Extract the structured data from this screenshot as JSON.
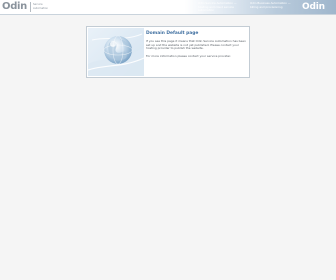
{
  "header": {
    "logo_text": "Odin",
    "logo_subtitle": "Service Automation",
    "links_col1": "Odin Service Automation — hosting and cloud service automation",
    "links_col2": "Odin Business Automation — billing and provisioning",
    "right_logo_text": "Odin"
  },
  "panel": {
    "title": "Domain Default page",
    "paragraph1": "If you see this page it means that Odin Service Automation has been set up and the website is not yet published. Please contact your hosting provider to publish the website.",
    "paragraph2": "For more information please contact your service provider."
  },
  "colors": {
    "title": "#3f6fa0",
    "background": "#f5f5f5",
    "panel_border": "#c3ccd4"
  }
}
